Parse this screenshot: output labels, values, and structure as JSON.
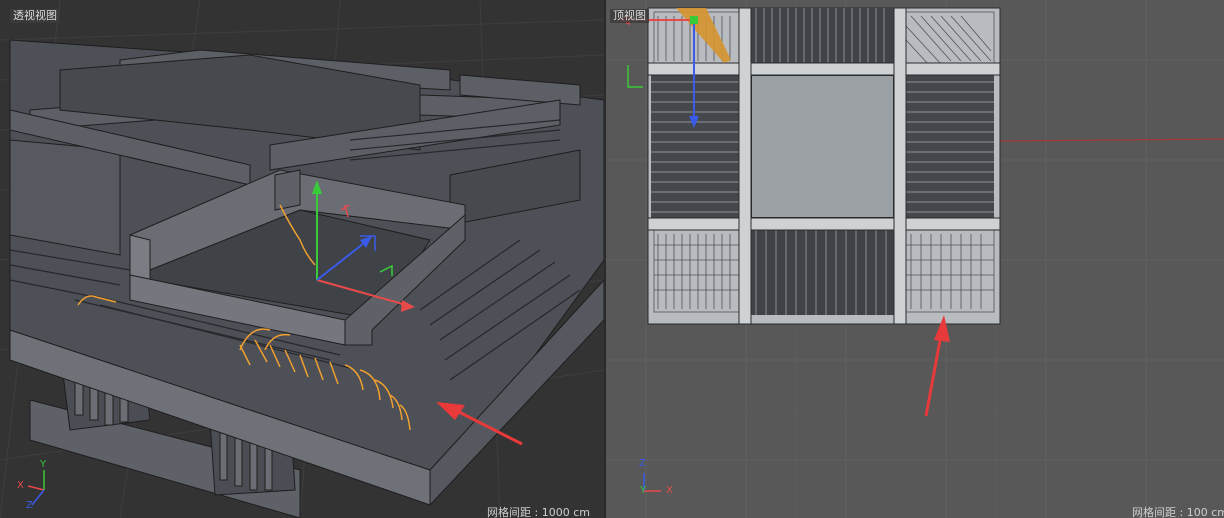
{
  "viewports": {
    "perspective": {
      "label": "透视视图",
      "grid_spacing": "网格间距 : 1000 cm"
    },
    "top": {
      "label": "顶视图",
      "grid_spacing": "网格间距 : 100 cm"
    }
  },
  "axes": {
    "x": "X",
    "y": "Y",
    "z": "Z"
  },
  "colors": {
    "grid_dark": "#333333",
    "grid_light": "#6a6a6a",
    "model": "#5a5d63",
    "model_edge": "#1e1e1e",
    "selected_edges": "#f0a030",
    "arrow": "#e83a3a",
    "axis_x": "#e84a4a",
    "axis_y": "#3acb3a",
    "axis_z": "#3a5ae8"
  },
  "icons": [
    "perspective-viewport",
    "top-viewport",
    "axis-gizmo",
    "red-annotation-arrow"
  ]
}
